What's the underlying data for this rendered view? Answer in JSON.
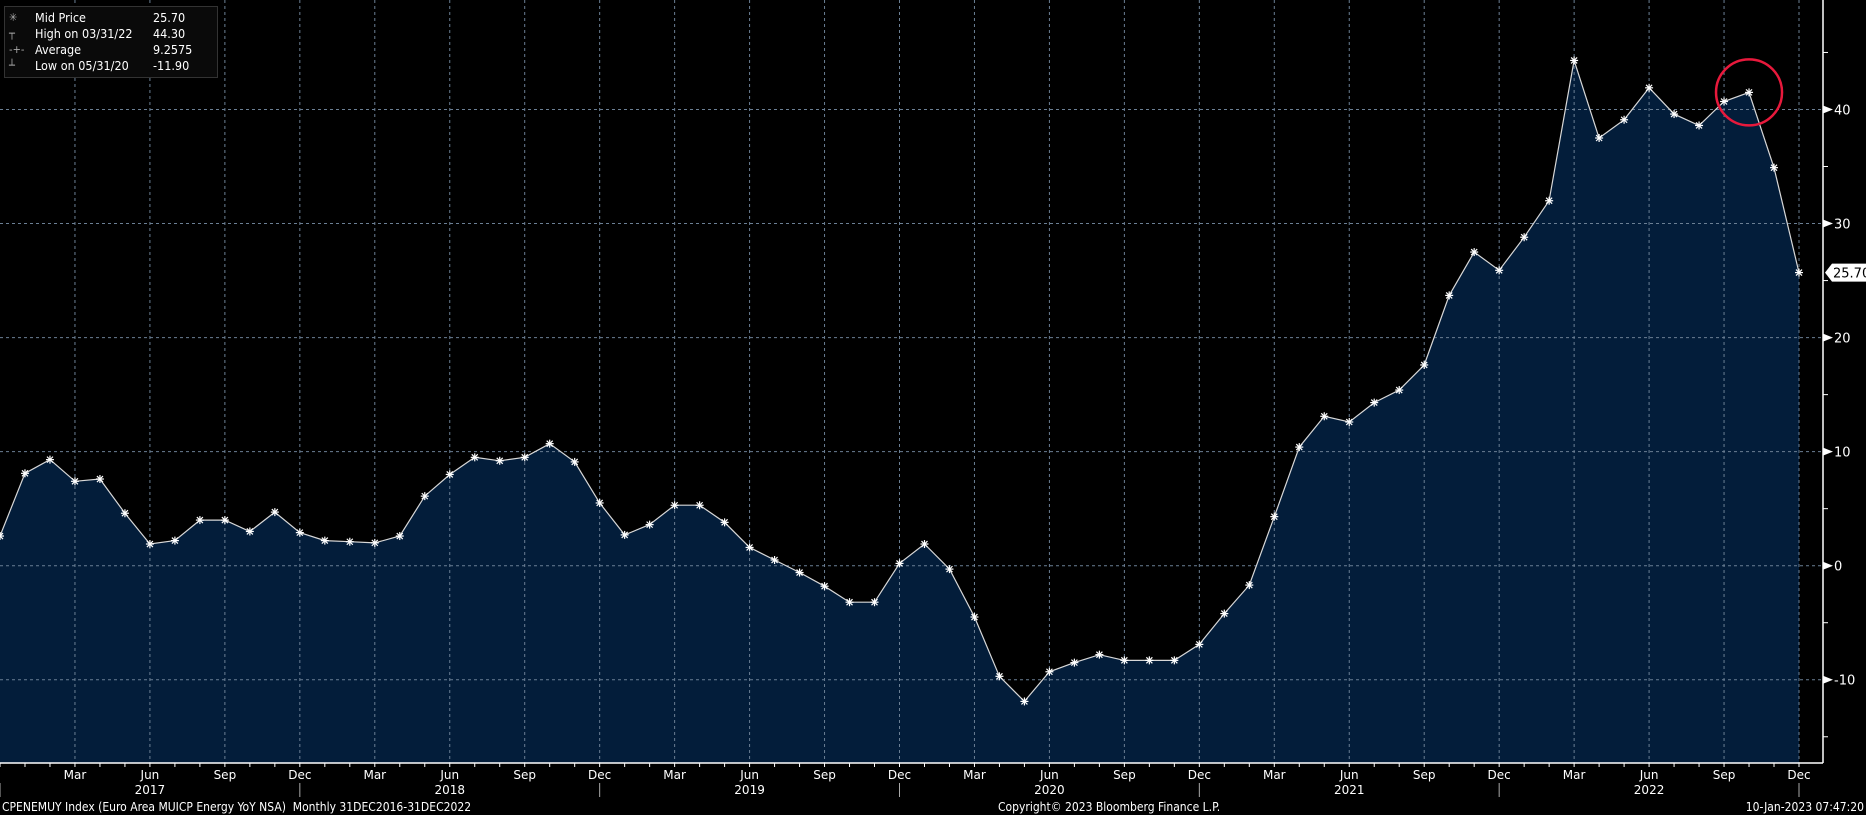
{
  "chart_data": {
    "type": "area",
    "title": "CPENEMUY Index (Euro Area MUICP Energy YoY NSA)",
    "frequency": "Monthly",
    "range": "31DEC2016-31DEC2022",
    "start": "2016-12",
    "x_labels": [
      {
        "m": 3,
        "label": "Mar"
      },
      {
        "m": 6,
        "label": "Jun"
      },
      {
        "m": 9,
        "label": "Sep"
      },
      {
        "m": 12,
        "label": "Dec"
      }
    ],
    "years": [
      "2017",
      "2018",
      "2019",
      "2020",
      "2021",
      "2022"
    ],
    "y_ticks": [
      40,
      30,
      20,
      10,
      0,
      -10
    ],
    "ylim": [
      -17.3,
      49.6
    ],
    "last_value_label": "25.70",
    "series": [
      {
        "name": "Mid Price",
        "values": [
          2.6,
          8.1,
          9.3,
          7.4,
          7.6,
          4.6,
          1.9,
          2.2,
          4.0,
          4.0,
          3.0,
          4.7,
          2.9,
          2.2,
          2.1,
          2.0,
          2.6,
          6.1,
          8.0,
          9.5,
          9.2,
          9.5,
          10.7,
          9.1,
          5.5,
          2.7,
          3.6,
          5.3,
          5.3,
          3.8,
          1.6,
          0.5,
          -0.6,
          -1.8,
          -3.2,
          -3.2,
          0.2,
          1.9,
          -0.3,
          -4.5,
          -9.7,
          -11.9,
          -9.3,
          -8.5,
          -7.8,
          -8.3,
          -8.3,
          -8.3,
          -6.9,
          -4.2,
          -1.7,
          4.3,
          10.4,
          13.1,
          12.6,
          14.3,
          15.4,
          17.6,
          23.7,
          27.5,
          25.9,
          28.8,
          32.0,
          44.3,
          37.5,
          39.1,
          41.9,
          39.6,
          38.6,
          40.7,
          41.5,
          34.9,
          25.7
        ]
      }
    ],
    "highlight": {
      "index": 70,
      "color": "#e8193c"
    },
    "colors": {
      "fill": "#031d3a",
      "line": "#d8d8d8",
      "grid": "#6b7f94"
    }
  },
  "legend": [
    {
      "icon": "✳",
      "label": "Mid Price",
      "value": "25.70"
    },
    {
      "icon": "┬",
      "label": "High on 03/31/22",
      "value": "44.30"
    },
    {
      "icon": "-+-",
      "label": "Average",
      "value": "9.2575"
    },
    {
      "icon": "┴",
      "label": "Low on 05/31/20",
      "value": "-11.90"
    }
  ],
  "footer": {
    "source": "CPENEMUY Index (Euro Area MUICP Energy YoY NSA)  Monthly 31DEC2016-31DEC2022",
    "copyright": "Copyright© 2023 Bloomberg Finance L.P.",
    "timestamp": "10-Jan-2023 07:47:20"
  }
}
